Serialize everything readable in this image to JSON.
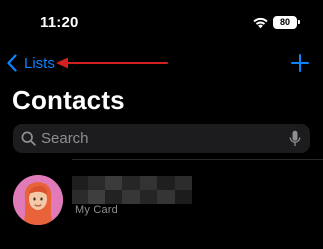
{
  "status_bar": {
    "time": "11:20",
    "battery_level": "80",
    "icons": [
      "wifi-icon",
      "battery-icon"
    ]
  },
  "nav": {
    "back_label": "Lists",
    "back_icon": "chevron-left-icon",
    "add_icon": "plus-icon",
    "annotation_icon": "red-arrow-icon"
  },
  "page": {
    "title": "Contacts"
  },
  "search": {
    "placeholder": "Search",
    "icon": "search-icon",
    "mic_icon": "microphone-icon"
  },
  "my_card": {
    "label": "My Card",
    "name_redacted": true,
    "avatar": "memoji-avatar"
  },
  "colors": {
    "background": "#000000",
    "accent": "#0a84ff",
    "search_bg": "#1c1c1e",
    "secondary_text": "#8e8e93",
    "annotation": "#d32020",
    "avatar_bg": "#e07ab8"
  }
}
